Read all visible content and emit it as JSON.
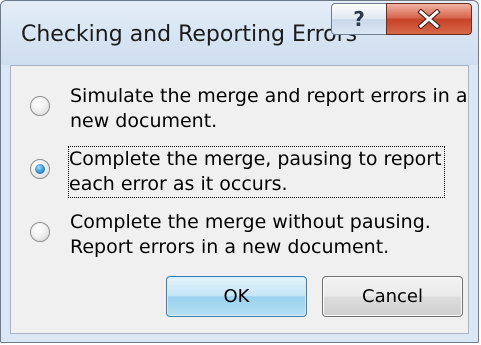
{
  "dialog": {
    "title": "Checking and Reporting Errors",
    "help_label": "?",
    "close_label": "X"
  },
  "options": [
    {
      "label": "Simulate the merge and report errors in a\nnew document.",
      "selected": false,
      "mnemonic": "S"
    },
    {
      "label": "Complete the merge, pausing to report\neach error as it occurs.",
      "selected": true,
      "mnemonic": "C"
    },
    {
      "label": "Complete the merge without pausing.\nReport errors in a new document.",
      "selected": false,
      "mnemonic": "m"
    }
  ],
  "buttons": {
    "ok_label": "OK",
    "cancel_label": "Cancel"
  }
}
